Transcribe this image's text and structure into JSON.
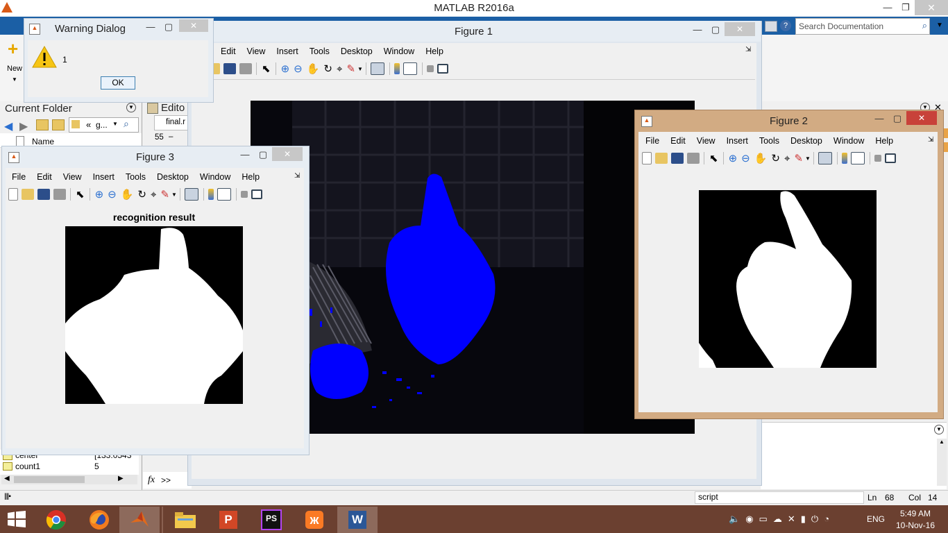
{
  "app": {
    "title": "MATLAB R2016a",
    "search_placeholder": "Search Documentation",
    "new_label": "New"
  },
  "current_folder": {
    "title": "Current Folder",
    "path": "g...",
    "path_prefix": "«",
    "column_name": "Name"
  },
  "editor": {
    "title": "Edito",
    "tab": "final.r",
    "line_num": "55",
    "line_mark": "–"
  },
  "workspace": {
    "rows": [
      {
        "name": "center",
        "value": "[133.0543"
      },
      {
        "name": "count1",
        "value": "5"
      }
    ]
  },
  "command": {
    "fx": "fx",
    "prompt": ">>"
  },
  "status": {
    "mode": "script",
    "ln_label": "Ln",
    "ln": "68",
    "col_label": "Col",
    "col": "14"
  },
  "warning": {
    "title": "Warning Dialog",
    "message": "1",
    "ok": "OK"
  },
  "figure_menu": [
    "File",
    "Edit",
    "View",
    "Insert",
    "Tools",
    "Desktop",
    "Window",
    "Help"
  ],
  "fig1": {
    "title": "Figure 1"
  },
  "fig2": {
    "title": "Figure 2"
  },
  "fig3": {
    "title": "Figure 3",
    "plot_title": "recognition result"
  },
  "taskbar": {
    "time": "5:49 AM",
    "date": "10-Nov-16",
    "lang": "ENG"
  },
  "colors": {
    "taskbar": "#6b4030",
    "fig2_frame": "#d2ab83",
    "blob": "#0000ff"
  }
}
